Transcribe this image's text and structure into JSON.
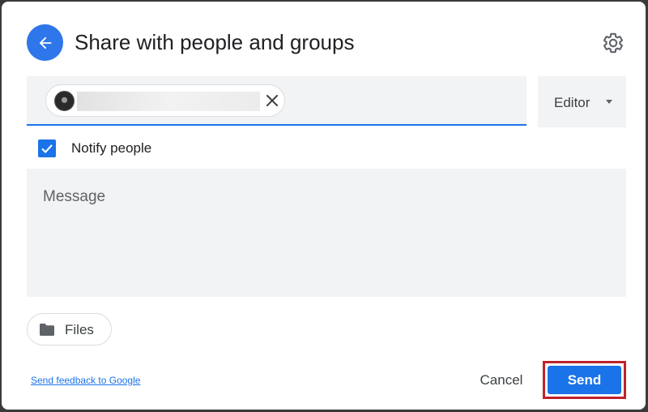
{
  "dialog": {
    "title": "Share with people and groups",
    "back_icon": "arrow-back-icon",
    "settings_icon": "gear-icon"
  },
  "recipients": {
    "chip_name": "",
    "chip_avatar": "avatar",
    "remove_icon": "close-icon"
  },
  "role": {
    "selected": "Editor",
    "caret_icon": "caret-down-icon"
  },
  "notify": {
    "label": "Notify people",
    "checked": true
  },
  "message": {
    "placeholder": "Message",
    "value": ""
  },
  "files": {
    "label": "Files",
    "icon": "folder-icon"
  },
  "footer": {
    "feedback_link": "Send feedback to Google",
    "cancel_label": "Cancel",
    "send_label": "Send"
  },
  "colors": {
    "accent": "#1a73e8",
    "back_button": "#2f76ea",
    "field_background": "#f1f3f4",
    "highlight_outline": "#c0222b"
  }
}
